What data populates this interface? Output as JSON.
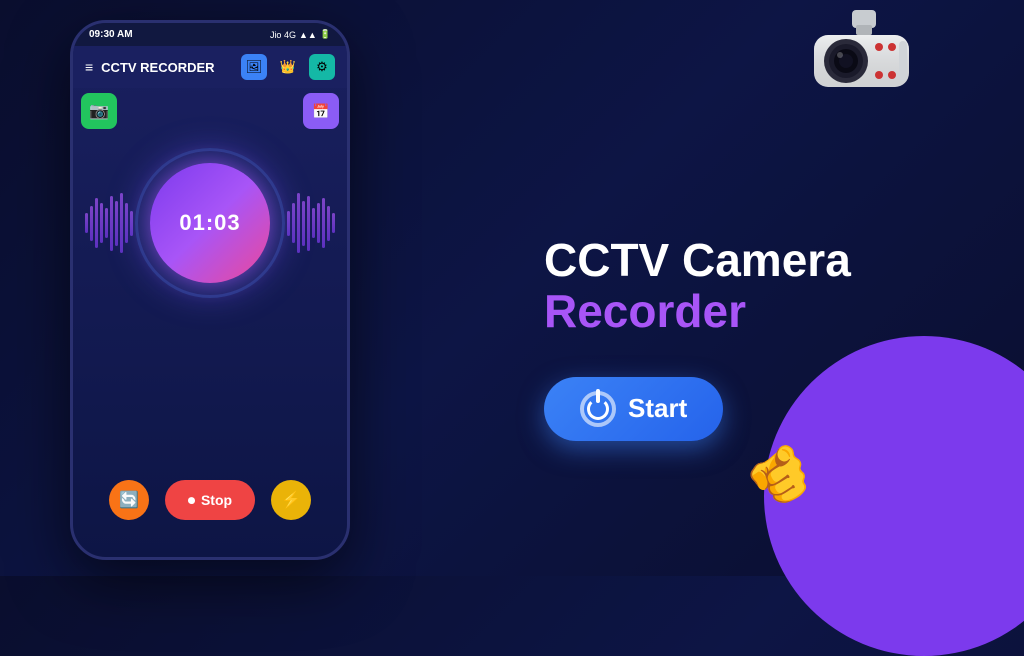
{
  "app": {
    "title": "CCTV RECORDER",
    "status_bar": {
      "time": "09:30 AM",
      "carrier": "Jio 4G",
      "signal": "▲▲",
      "battery": "▮"
    }
  },
  "phone": {
    "topbar": {
      "menu_icon": "≡",
      "title": "CCTV RECORDER",
      "icons": [
        "🖼",
        "👑",
        "⚙"
      ]
    },
    "buttons": {
      "green_cam": "📷",
      "purple_schedule": "📅"
    },
    "timer": {
      "display": "01:03"
    },
    "controls": {
      "rotate_icon": "🔄",
      "stop_label": "Stop",
      "stop_icon": "⏺",
      "flash_icon": "⚡"
    }
  },
  "hero": {
    "title_line1": "CCTV Camera",
    "title_line2": "Recorder",
    "start_button_label": "Start"
  },
  "colors": {
    "background": "#0a0e2e",
    "accent_purple": "#a855f7",
    "accent_blue": "#3b82f6",
    "btn_red": "#ef4444",
    "btn_orange": "#f97316",
    "btn_yellow": "#eab308"
  }
}
